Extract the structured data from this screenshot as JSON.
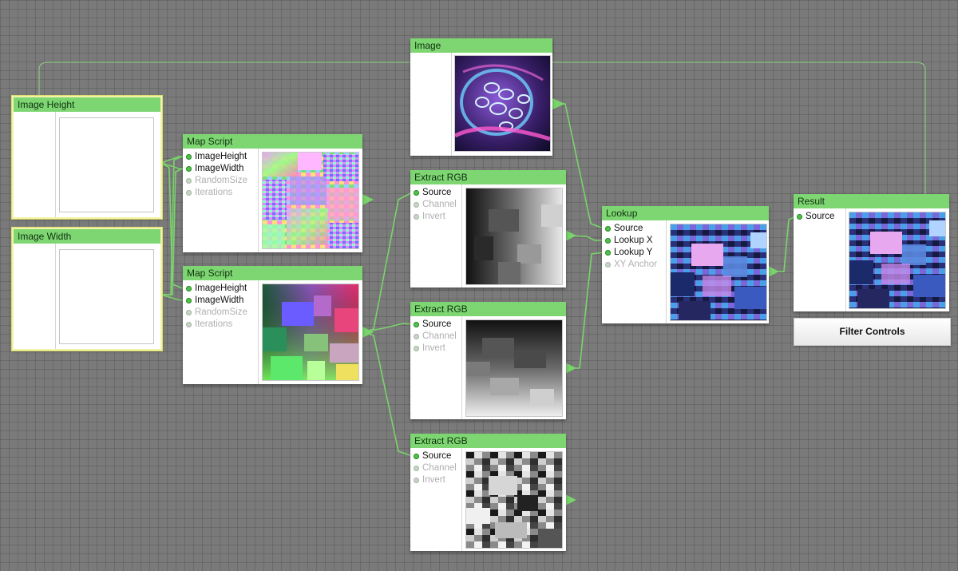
{
  "nodes": {
    "image_height": {
      "title": "Image Height"
    },
    "image_width": {
      "title": "Image Width"
    },
    "map_script_1": {
      "title": "Map Script",
      "ports": [
        "ImageHeight",
        "ImageWidth",
        "RandomSize",
        "Iterations"
      ]
    },
    "map_script_2": {
      "title": "Map Script",
      "ports": [
        "ImageHeight",
        "ImageWidth",
        "RandomSize",
        "Iterations"
      ]
    },
    "image": {
      "title": "Image"
    },
    "extract_rgb_1": {
      "title": "Extract RGB",
      "ports": [
        "Source",
        "Channel",
        "Invert"
      ]
    },
    "extract_rgb_2": {
      "title": "Extract RGB",
      "ports": [
        "Source",
        "Channel",
        "Invert"
      ]
    },
    "extract_rgb_3": {
      "title": "Extract RGB",
      "ports": [
        "Source",
        "Channel",
        "Invert"
      ]
    },
    "lookup": {
      "title": "Lookup",
      "ports": [
        "Source",
        "Lookup X",
        "Lookup Y",
        "XY Anchor"
      ]
    },
    "result": {
      "title": "Result",
      "ports": [
        "Source"
      ]
    }
  },
  "filter_controls": {
    "label": "Filter Controls"
  },
  "colors": {
    "accent": "#7ed672",
    "wire": "#79d46b",
    "selection": "#f3f3a8",
    "canvas": "#7a7a7a"
  }
}
